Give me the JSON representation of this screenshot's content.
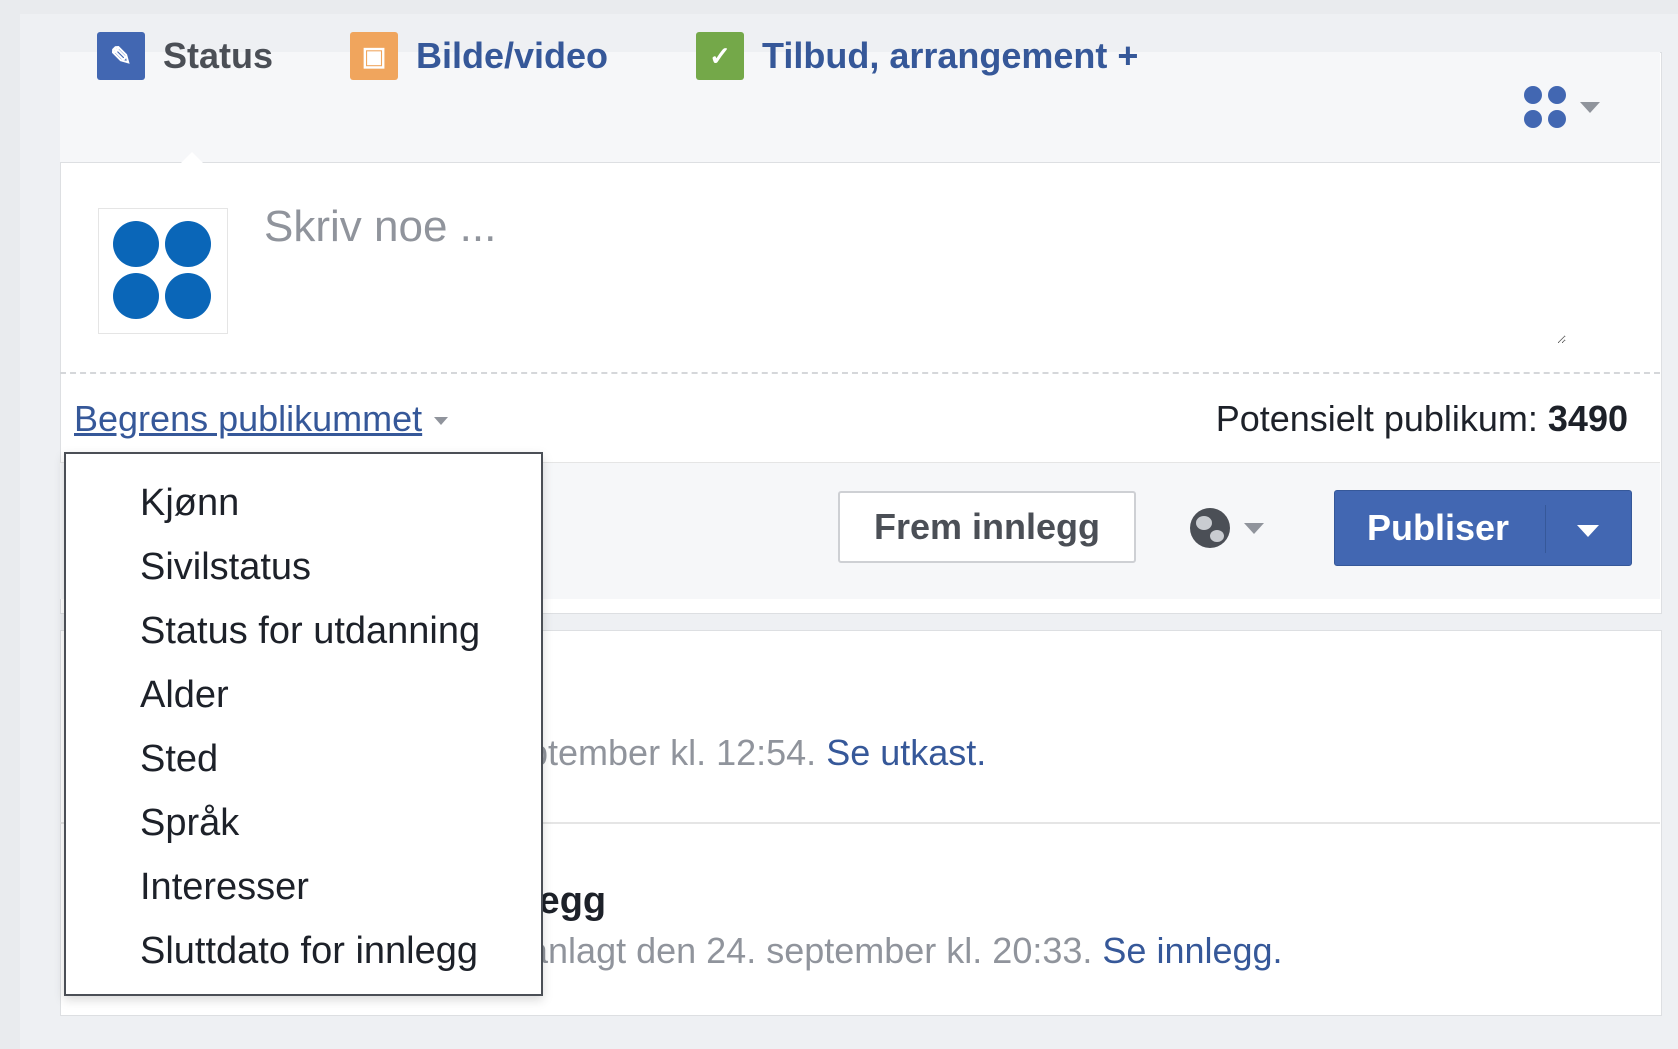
{
  "tabs": [
    {
      "label": "Status"
    },
    {
      "label": "Bilde/video"
    },
    {
      "label": "Tilbud, arrangement +"
    }
  ],
  "composer": {
    "placeholder": "Skriv noe ...",
    "restrict_label": "Begrens publikummet",
    "audience_label": "Potensielt publikum:",
    "audience_count": "3490"
  },
  "actions": {
    "boost_label": "Frem innlegg",
    "publish_label": "Publiser"
  },
  "dropdown": {
    "items": [
      "Kjønn",
      "Sivilstatus",
      "Status for utdanning",
      "Alder",
      "Sted",
      "Språk",
      "Interesser",
      "Sluttdato for innlegg"
    ]
  },
  "feed": {
    "draft_text": "ptember kl. 12:54.",
    "draft_link": "Se utkast.",
    "scheduled_title": "legg",
    "scheduled_text": "anlagt den 24. september kl. 20:33.",
    "scheduled_link": "Se innlegg."
  },
  "colors": {
    "brand": "#4267b2",
    "link": "#365899",
    "avatar_blue": "#0a66b8"
  }
}
